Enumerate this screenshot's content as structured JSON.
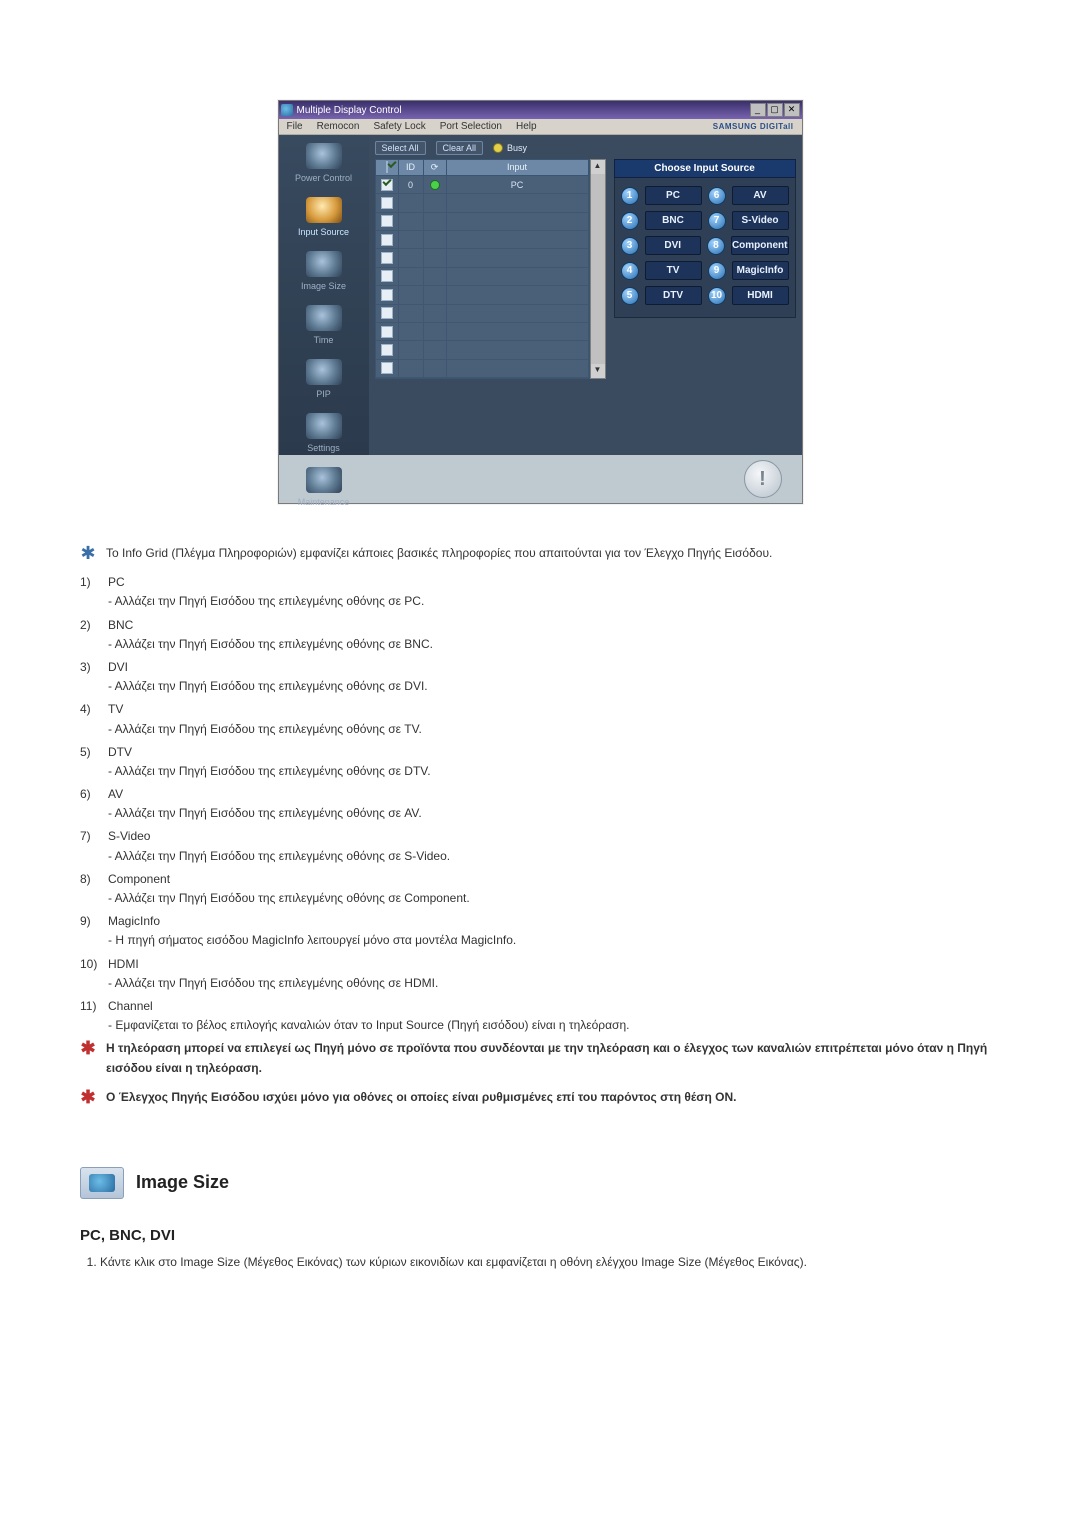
{
  "app": {
    "title": "Multiple Display Control",
    "brand": "SAMSUNG DIGITall",
    "menubar": [
      "File",
      "Remocon",
      "Safety Lock",
      "Port Selection",
      "Help"
    ],
    "win_buttons": {
      "minimize": "_",
      "restore": "▢",
      "close": "✕"
    }
  },
  "sidebar": {
    "items": [
      {
        "label": "Power Control"
      },
      {
        "label": "Input Source"
      },
      {
        "label": "Image Size"
      },
      {
        "label": "Time"
      },
      {
        "label": "PIP"
      },
      {
        "label": "Settings"
      },
      {
        "label": "Maintenance"
      }
    ],
    "active_index": 1
  },
  "toolstrip": {
    "select_all": "Select All",
    "clear_all": "Clear All",
    "busy": "Busy"
  },
  "grid": {
    "headers": {
      "id": "ID",
      "status_icon": "⟳",
      "input": "Input"
    },
    "rows": [
      {
        "checked": true,
        "id": "0",
        "status_green": true,
        "input": "PC"
      },
      {
        "checked": false,
        "id": "",
        "status_green": false,
        "input": ""
      },
      {
        "checked": false,
        "id": "",
        "status_green": false,
        "input": ""
      },
      {
        "checked": false,
        "id": "",
        "status_green": false,
        "input": ""
      },
      {
        "checked": false,
        "id": "",
        "status_green": false,
        "input": ""
      },
      {
        "checked": false,
        "id": "",
        "status_green": false,
        "input": ""
      },
      {
        "checked": false,
        "id": "",
        "status_green": false,
        "input": ""
      },
      {
        "checked": false,
        "id": "",
        "status_green": false,
        "input": ""
      },
      {
        "checked": false,
        "id": "",
        "status_green": false,
        "input": ""
      },
      {
        "checked": false,
        "id": "",
        "status_green": false,
        "input": ""
      },
      {
        "checked": false,
        "id": "",
        "status_green": false,
        "input": ""
      }
    ]
  },
  "input_panel": {
    "title": "Choose Input Source",
    "left": [
      {
        "num": "1",
        "label": "PC"
      },
      {
        "num": "2",
        "label": "BNC"
      },
      {
        "num": "3",
        "label": "DVI"
      },
      {
        "num": "4",
        "label": "TV"
      },
      {
        "num": "5",
        "label": "DTV"
      }
    ],
    "right": [
      {
        "num": "6",
        "label": "AV"
      },
      {
        "num": "7",
        "label": "S-Video"
      },
      {
        "num": "8",
        "label": "Component"
      },
      {
        "num": "9",
        "label": "MagicInfo"
      },
      {
        "num": "10",
        "label": "HDMI"
      }
    ]
  },
  "notes": {
    "intro": "Το Info Grid (Πλέγμα Πληροφοριών) εμφανίζει κάποιες βασικές πληροφορίες που απαιτούνται για τον Έλεγχο Πηγής Εισόδου.",
    "items": [
      {
        "num": "1)",
        "title": "PC",
        "desc": "- Αλλάζει την Πηγή Εισόδου της επιλεγμένης οθόνης σε PC."
      },
      {
        "num": "2)",
        "title": "BNC",
        "desc": "- Αλλάζει την Πηγή Εισόδου της επιλεγμένης οθόνης σε BNC."
      },
      {
        "num": "3)",
        "title": "DVI",
        "desc": "- Αλλάζει την Πηγή Εισόδου της επιλεγμένης οθόνης σε DVI."
      },
      {
        "num": "4)",
        "title": "TV",
        "desc": "- Αλλάζει την Πηγή Εισόδου της επιλεγμένης οθόνης σε TV."
      },
      {
        "num": "5)",
        "title": "DTV",
        "desc": "- Αλλάζει την Πηγή Εισόδου της επιλεγμένης οθόνης σε DTV."
      },
      {
        "num": "6)",
        "title": "AV",
        "desc": "- Αλλάζει την Πηγή Εισόδου της επιλεγμένης οθόνης σε AV."
      },
      {
        "num": "7)",
        "title": "S-Video",
        "desc": "- Αλλάζει την Πηγή Εισόδου της επιλεγμένης οθόνης σε S-Video."
      },
      {
        "num": "8)",
        "title": "Component",
        "desc": "- Αλλάζει την Πηγή Εισόδου της επιλεγμένης οθόνης σε Component."
      },
      {
        "num": "9)",
        "title": "MagicInfo",
        "desc": "- Η πηγή σήματος εισόδου MagicInfo λειτουργεί μόνο στα μοντέλα MagicInfo."
      },
      {
        "num": "10)",
        "title": "HDMI",
        "desc": "- Αλλάζει την Πηγή Εισόδου της επιλεγμένης οθόνης σε HDMI."
      },
      {
        "num": "11)",
        "title": "Channel",
        "desc": "- Εμφανίζεται το βέλος επιλογής καναλιών όταν το Input Source (Πηγή εισόδου) είναι η τηλεόραση."
      }
    ],
    "warn1": "Η τηλεόραση μπορεί να επιλεγεί ως Πηγή μόνο σε προϊόντα που συνδέονται με την τηλεόραση και ο έλεγχος των καναλιών επιτρέπεται μόνο όταν η Πηγή εισόδου είναι η τηλεόραση.",
    "warn2": "Ο Έλεγχος Πηγής Εισόδου ισχύει μόνο για οθόνες οι οποίες είναι ρυθμισμένες επί του παρόντος στη θέση ON."
  },
  "section": {
    "title": "Image Size",
    "subtitle": "PC, BNC, DVI",
    "step1": "Κάντε κλικ στο Image Size (Μέγεθος Εικόνας) των κύριων εικονιδίων και εμφανίζεται η οθόνη ελέγχου Image Size (Μέγεθος Εικόνας)."
  }
}
